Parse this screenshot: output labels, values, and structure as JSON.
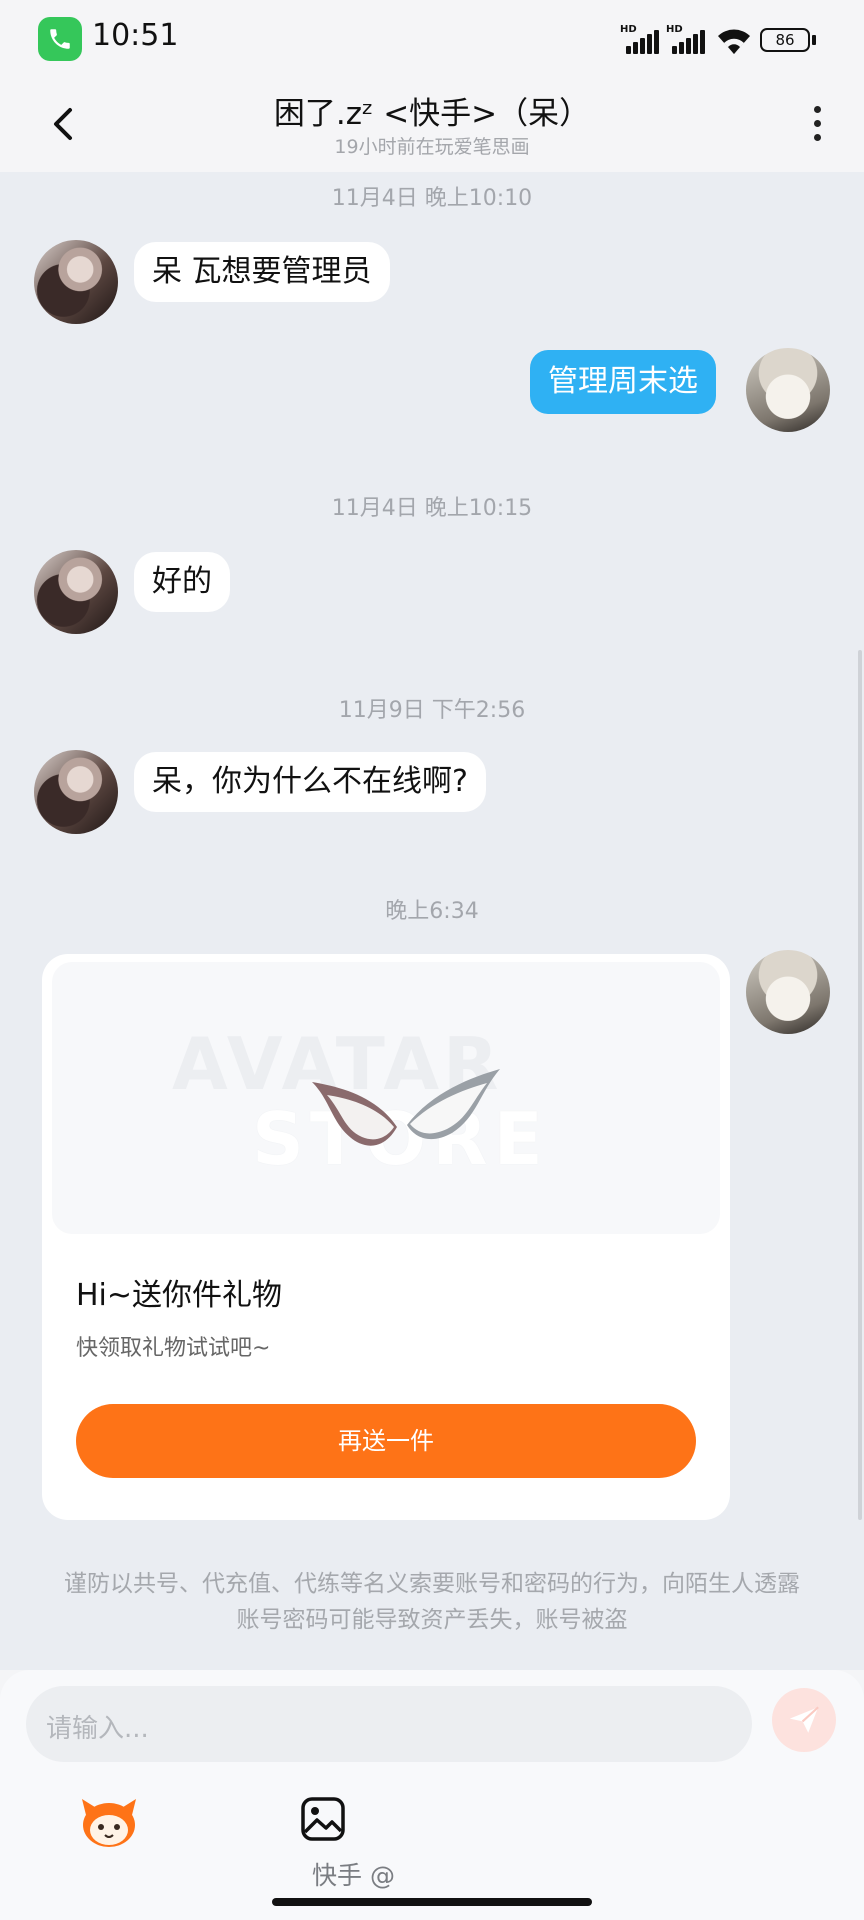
{
  "status_bar": {
    "time": "10:51",
    "signal1_label": "HD",
    "signal2_label": "HD",
    "battery": "86"
  },
  "header": {
    "title": "困了.zᶻ <快手>（呆）",
    "subtitle": "19小时前在玩爱笔思画"
  },
  "messages": [
    {
      "type": "timestamp",
      "text": "11月4日 晚上10:10"
    },
    {
      "type": "received",
      "text": "呆 瓦想要管理员"
    },
    {
      "type": "sent",
      "text": "管理周末选"
    },
    {
      "type": "timestamp",
      "text": "11月4日 晚上10:15"
    },
    {
      "type": "received",
      "text": "好的"
    },
    {
      "type": "timestamp",
      "text": "11月9日 下午2:56"
    },
    {
      "type": "received",
      "text": "呆，你为什么不在线啊?"
    },
    {
      "type": "timestamp",
      "text": "晚上6:34"
    }
  ],
  "gift_card": {
    "banner_watermark_line1": "AVATAR",
    "banner_watermark_line2": "STORE",
    "title": "Hi~送你件礼物",
    "subtitle": "快领取礼物试试吧~",
    "button_label": "再送一件"
  },
  "warning": "谨防以共号、代充值、代练等名义索要账号和密码的行为，向陌生人透露账号密码可能导致资产丢失，账号被盗",
  "input": {
    "placeholder": "请输入..."
  },
  "watermark": "快手 @",
  "colors": {
    "sent_bubble": "#2fb1f3",
    "gift_button": "#fe7317",
    "send_button": "#fde2de",
    "call_pill": "#35c75a"
  },
  "icons": [
    "phone-icon",
    "wifi-icon",
    "back-chevron-icon",
    "more-vertical-icon",
    "send-icon",
    "image-icon",
    "kuaishou-mascot-icon"
  ]
}
